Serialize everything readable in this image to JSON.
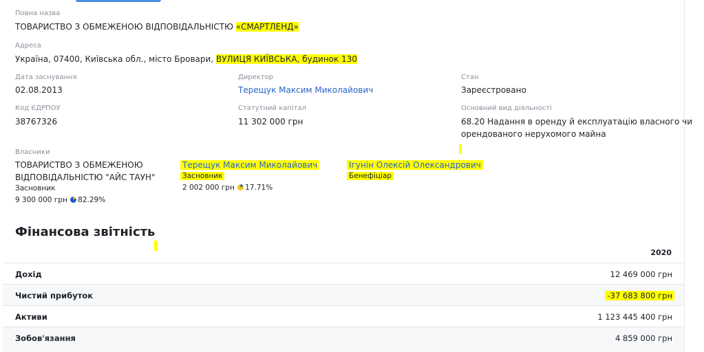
{
  "company": {
    "full_name_label": "Повна назва",
    "full_name": "ТОВАРИСТВО З ОБМЕЖЕНОЮ ВІДПОВІДАЛЬНІСТЮ ",
    "full_name_quoted": "«СМАРТЛЕНД»",
    "address_label": "Адреса",
    "address_prefix": "Україна, 07400, Київська обл., місто Бровари, ",
    "address_highlight": "ВУЛИЦЯ КИЇВСЬКА, будинок 130",
    "founded_label": "Дата заснування",
    "founded": "02.08.2013",
    "director_label": "Директор",
    "director": "Терещук Максим Миколайович",
    "status_label": "Стан",
    "status": "Зареєстровано",
    "edrpou_label": "Код ЄДРПОУ",
    "edrpou": "38767326",
    "capital_label": "Статутний капітал",
    "capital": "11 302 000 грн",
    "activity_label": "Основний вид діяльності",
    "activity_line1": "68.20 Надання в оренду й експлуатацію власного чи",
    "activity_line2": "орендованого нерухомого майна"
  },
  "owners": {
    "label": "Власники",
    "items": [
      {
        "name_line1": "ТОВАРИСТВО З ОБМЕЖЕНОЮ",
        "name_line2": "ВІДПОВІДАЛЬНІСТЮ \"АЙС ТАУН\"",
        "role": "Засновник",
        "amount": "9 300 000 грн",
        "percent": "82.29%"
      },
      {
        "name": "Терещук Максим Миколайович",
        "role": "Засновник",
        "amount": "2 002 000 грн",
        "percent": "17.71%"
      },
      {
        "name": "Ігунін Олексій Олександрович",
        "role": "Бенефіціар"
      }
    ]
  },
  "finance": {
    "title": "Фінансова звітність",
    "year": "2020",
    "rows": [
      {
        "label": "Дохід",
        "value": "12 469 000 грн"
      },
      {
        "label": "Чистий прибуток",
        "value": "-37 683 800 грн"
      },
      {
        "label": "Активи",
        "value": "1 123 445 400 грн"
      },
      {
        "label": "Зобов'язання",
        "value": "4 859 000 грн"
      }
    ]
  },
  "colors": {
    "highlight": "#ffff00",
    "link": "#2a63c9",
    "pie_blue": "#1e5fc9",
    "pie_yellow": "#f7c512"
  }
}
